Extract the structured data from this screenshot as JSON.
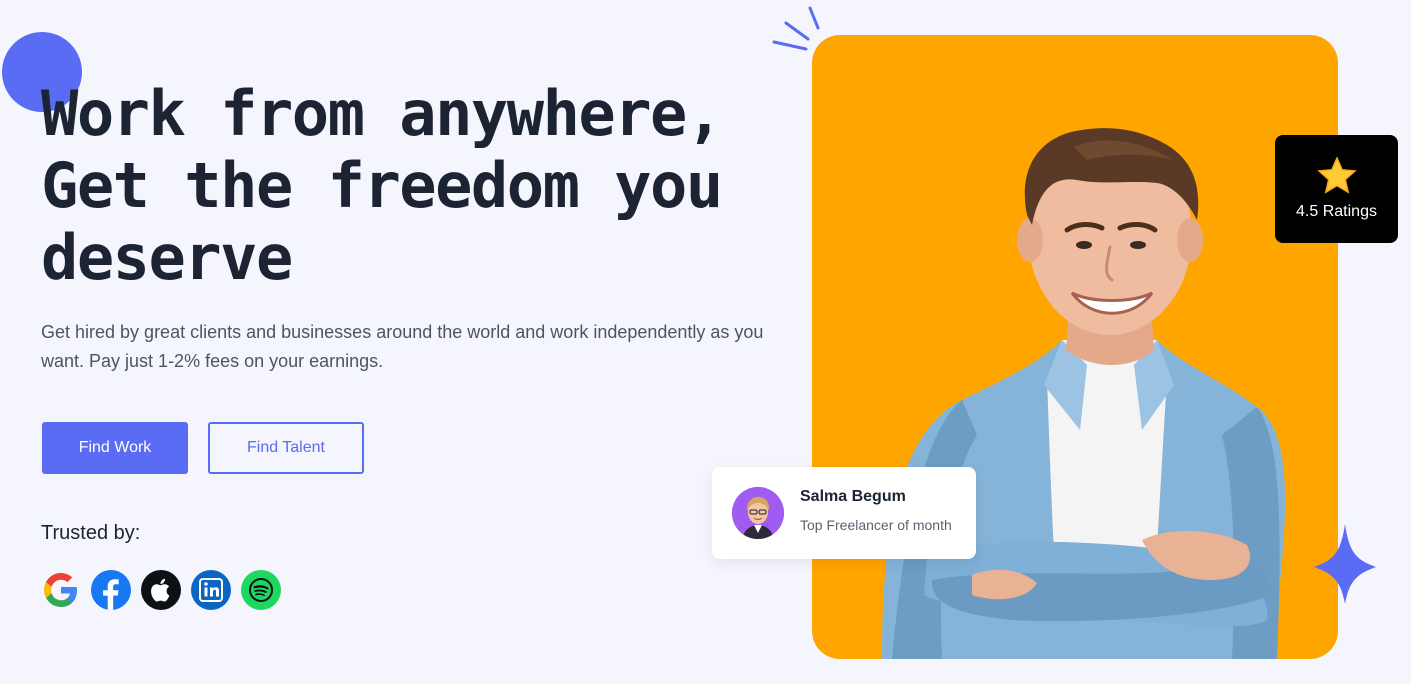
{
  "hero": {
    "title_lines": [
      "Work from anywhere,",
      "Get the freedom you",
      "deserve"
    ],
    "subtitle": "Get hired by great clients and businesses around the world and work independently as you want. Pay just 1-2% fees on your earnings."
  },
  "buttons": {
    "primary_label": "Find Work",
    "secondary_label": "Find Talent"
  },
  "trusted": {
    "label": "Trusted by:",
    "brands": [
      "google-icon",
      "facebook-icon",
      "apple-icon",
      "linkedin-icon",
      "spotify-icon"
    ]
  },
  "rating": {
    "icon": "star-icon",
    "label": "4.5 Ratings"
  },
  "freelancer": {
    "name": "Salma Begum",
    "title": "Top Freelancer of month"
  },
  "colors": {
    "accent": "#5a6cf3",
    "card_background": "#ffa500",
    "page_background": "#f5f6fd",
    "heading": "#1c2434"
  }
}
